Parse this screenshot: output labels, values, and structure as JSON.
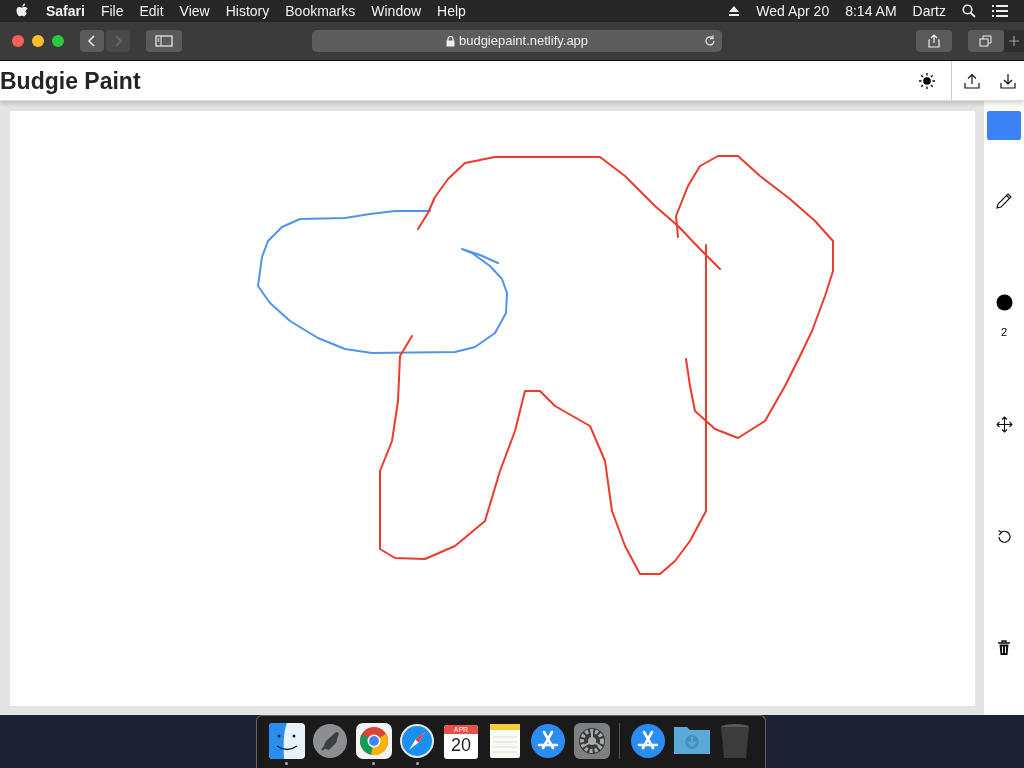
{
  "menu_bar": {
    "app": "Safari",
    "menus": [
      "File",
      "Edit",
      "View",
      "History",
      "Bookmarks",
      "Window",
      "Help"
    ],
    "date": "Wed Apr 20",
    "time": "8:14 AM",
    "user": "Dartz"
  },
  "browser": {
    "url": "budgiepaint.netlify.app",
    "back_disabled": false,
    "forward_disabled": true
  },
  "app": {
    "title": "Budgie Paint"
  },
  "tools": {
    "color": "#3b82f6",
    "brush_size": "2"
  },
  "dock": {
    "apps": [
      {
        "kind": "finder",
        "running": true
      },
      {
        "kind": "launchpad",
        "running": false
      },
      {
        "kind": "chrome",
        "running": true
      },
      {
        "kind": "safari",
        "running": true
      },
      {
        "kind": "calendar",
        "running": false,
        "month": "APR",
        "day": "20"
      },
      {
        "kind": "notes",
        "running": false
      },
      {
        "kind": "appstore",
        "running": false
      },
      {
        "kind": "settings",
        "running": false
      }
    ],
    "others": [
      {
        "kind": "appstore",
        "running": false
      },
      {
        "kind": "folder",
        "running": false
      },
      {
        "kind": "trash",
        "running": false
      }
    ]
  }
}
